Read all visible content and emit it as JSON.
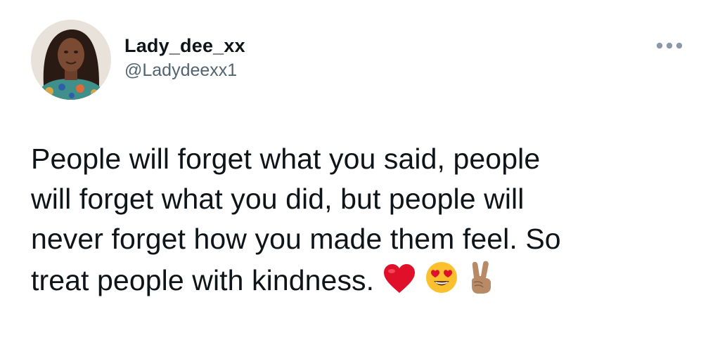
{
  "tweet": {
    "author": {
      "display_name": "Lady_dee_xx",
      "handle": "@Ladydeexx1",
      "avatar_icon": "profile-photo"
    },
    "more_icon": "more-horizontal-icon",
    "text_lines": [
      "People will forget what you said, people",
      "will forget what you did, but people will",
      "never forget how you made them feel. So",
      "treat people with kindness."
    ],
    "emojis": [
      "red-heart-emoji",
      "heart-eyes-emoji",
      "victory-hand-emoji"
    ]
  },
  "colors": {
    "text": "#0f1419",
    "secondary": "#536471",
    "heart": "#e0102b",
    "emoji_yellow": "#fbc02d"
  }
}
